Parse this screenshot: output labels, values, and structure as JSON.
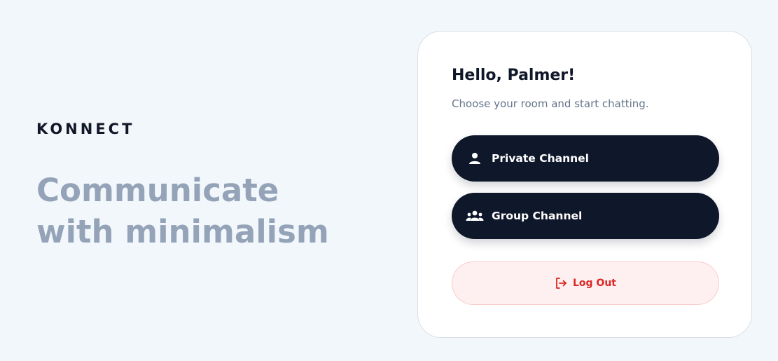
{
  "brand": {
    "name": "KONNECT"
  },
  "hero": {
    "tagline": "Communicate with minimalism"
  },
  "card": {
    "greeting": "Hello, Palmer!",
    "subtitle": "Choose your room and start chatting.",
    "buttons": [
      {
        "label": "Private Channel",
        "icon": "user-icon"
      },
      {
        "label": "Group Channel",
        "icon": "users-icon"
      }
    ],
    "logout": {
      "label": "Log Out",
      "icon": "logout-icon"
    }
  },
  "colors": {
    "background": "#f2f7fb",
    "primary_button": "#0f172a",
    "tagline": "#94a3b8",
    "danger": "#dc2626",
    "danger_bg": "#fef0f0"
  }
}
